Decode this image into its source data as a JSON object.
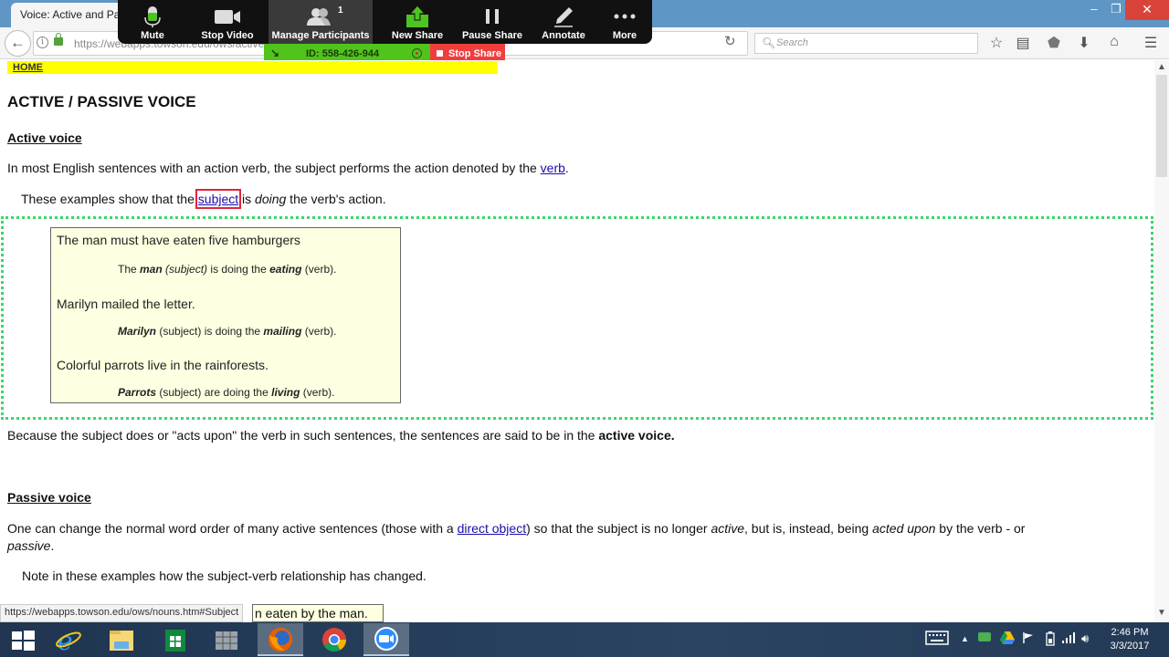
{
  "browser": {
    "tab_title": "Voice:  Active and Passive Voice",
    "url": "https://webapps.towson.edu/ows/activepass.htm",
    "search_placeholder": "Search",
    "window_controls": {
      "minimize": "–",
      "maximize": "❐",
      "close": "✕"
    }
  },
  "zoom_toolbar": {
    "buttons": [
      {
        "label": "Mute",
        "icon": "microphone-icon"
      },
      {
        "label": "Stop Video",
        "icon": "video-camera-icon"
      },
      {
        "label": "Manage Participants",
        "icon": "participants-icon",
        "badge": "1"
      },
      {
        "label": "New Share",
        "icon": "share-upload-icon"
      },
      {
        "label": "Pause Share",
        "icon": "pause-icon"
      },
      {
        "label": "Annotate",
        "icon": "pencil-icon"
      },
      {
        "label": "More",
        "icon": "ellipsis-icon"
      }
    ],
    "meeting_id": "ID: 558-426-944",
    "stop_share_label": "Stop Share",
    "colors": {
      "toolbar_bg": "#111111",
      "id_bar": "#51c41b",
      "stop_share": "#f03e3e"
    }
  },
  "page": {
    "home_link": "HOME",
    "title": "ACTIVE / PASSIVE VOICE",
    "active_heading": "Active voice",
    "active_intro": {
      "before": "In most English sentences with an action verb, the subject performs the action denoted by the ",
      "link": "verb",
      "after": "."
    },
    "examples_intro": {
      "before": "These examples show that the ",
      "link": "subject",
      "mid": " is  ",
      "em": "doing",
      "after": " the verb's action."
    },
    "examples": [
      {
        "sentence": "The man must have eaten five hamburgers",
        "note": {
          "pre": "The ",
          "subj": "man",
          "subj_tag": " (subject)",
          "mid": " is doing the ",
          "verb": "eating",
          "post": " (verb)."
        }
      },
      {
        "sentence": "Marilyn mailed the letter.",
        "note": {
          "pre": "",
          "subj": "Marilyn",
          "subj_tag": " (subject)",
          "mid": " is doing the ",
          "verb": "mailing",
          "post": " (verb)."
        }
      },
      {
        "sentence": "Colorful parrots live in the rainforests.",
        "note": {
          "pre": "",
          "subj": "Parrots",
          "subj_tag": " (subject)",
          "mid": " are doing the ",
          "verb": "living",
          "post": " (verb)."
        }
      }
    ],
    "active_conclusion": {
      "before": "Because the subject does or \"acts upon\" the verb in such sentences, the sentences are said to be in the ",
      "bold": "active voice."
    },
    "passive_heading": "Passive voice",
    "passive_intro": {
      "p1": "One can change the normal word order of many active sentences (those with a ",
      "link": "direct object",
      "p2": ") so that the subject is no longer ",
      "em1": "active",
      "p3": ", but is, instead, being ",
      "em2": "acted upon",
      "p4": " by the verb - or",
      "em3": "passive",
      "p5": "."
    },
    "passive_note": "Note in these examples how the subject-verb relationship has changed.",
    "partial_example": "n eaten by the man.",
    "status_url": "https://webapps.towson.edu/ows/nouns.htm#Subject"
  },
  "taskbar": {
    "apps": [
      {
        "name": "start-button"
      },
      {
        "name": "internet-explorer"
      },
      {
        "name": "file-explorer"
      },
      {
        "name": "store"
      },
      {
        "name": "app-grid"
      },
      {
        "name": "firefox",
        "active": true
      },
      {
        "name": "chrome"
      },
      {
        "name": "zoom",
        "active": true
      }
    ],
    "time": "2:46 PM",
    "date": "3/3/2017"
  }
}
